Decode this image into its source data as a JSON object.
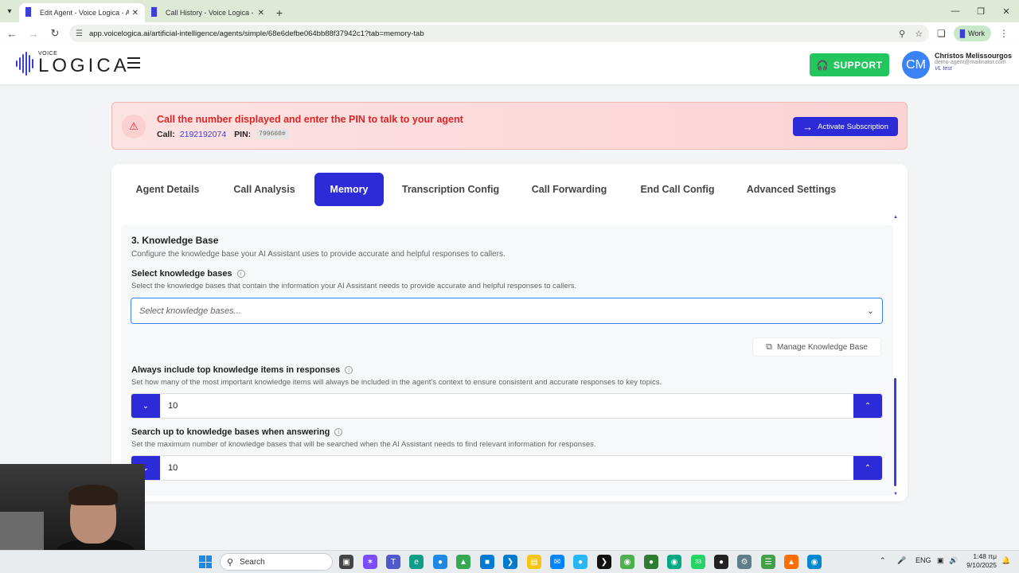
{
  "browser": {
    "tabs": [
      {
        "title": "Edit Agent - Voice Logica - AI P",
        "active": true
      },
      {
        "title": "Call History - Voice Logica - AI",
        "active": false
      }
    ],
    "url": "app.voicelogica.ai/artificial-intelligence/agents/simple/68e6defbe064bb88f37942c1?tab=memory-tab",
    "profile_label": "Work"
  },
  "header": {
    "logo_small": "VOICE",
    "logo_big": "LOGICA",
    "support_label": "SUPPORT",
    "avatar_initials": "CM",
    "user_name": "Christos Melissourgos",
    "user_email": "demo-agent@mailinator.com",
    "user_org": "VL test"
  },
  "alert": {
    "message": "Call the number displayed and enter the PIN to talk to your agent",
    "call_label": "Call:",
    "call_number": "2192192074",
    "pin_label": "PIN:",
    "pin_value": "799660#",
    "activate_label": "Activate Subscription"
  },
  "tabs": [
    {
      "label": "Agent Details"
    },
    {
      "label": "Call Analysis"
    },
    {
      "label": "Memory",
      "active": true
    },
    {
      "label": "Transcription Config"
    },
    {
      "label": "Call Forwarding"
    },
    {
      "label": "End Call Config"
    },
    {
      "label": "Advanced Settings"
    }
  ],
  "knowledge": {
    "section_title": "3. Knowledge Base",
    "section_desc": "Configure the knowledge base your AI Assistant uses to provide accurate and helpful responses to callers.",
    "select_label": "Select knowledge bases",
    "select_desc": "Select the knowledge bases that contain the information your AI Assistant needs to provide accurate and helpful responses to callers.",
    "select_placeholder": "Select knowledge bases...",
    "manage_label": "Manage Knowledge Base",
    "top_items_label": "Always include top knowledge items in responses",
    "top_items_desc": "Set how many of the most important knowledge items will always be included in the agent's context to ensure consistent and accurate responses to key topics.",
    "top_items_value": "10",
    "search_label": "Search up to knowledge bases when answering",
    "search_desc": "Set the maximum number of knowledge bases that will be searched when the AI Assistant needs to find relevant information for responses.",
    "search_value": "10"
  },
  "taskbar": {
    "search_label": "Search",
    "lang": "ENG",
    "time": "1:48 πμ",
    "date": "9/10/2025",
    "whatsapp_badge": "33"
  }
}
